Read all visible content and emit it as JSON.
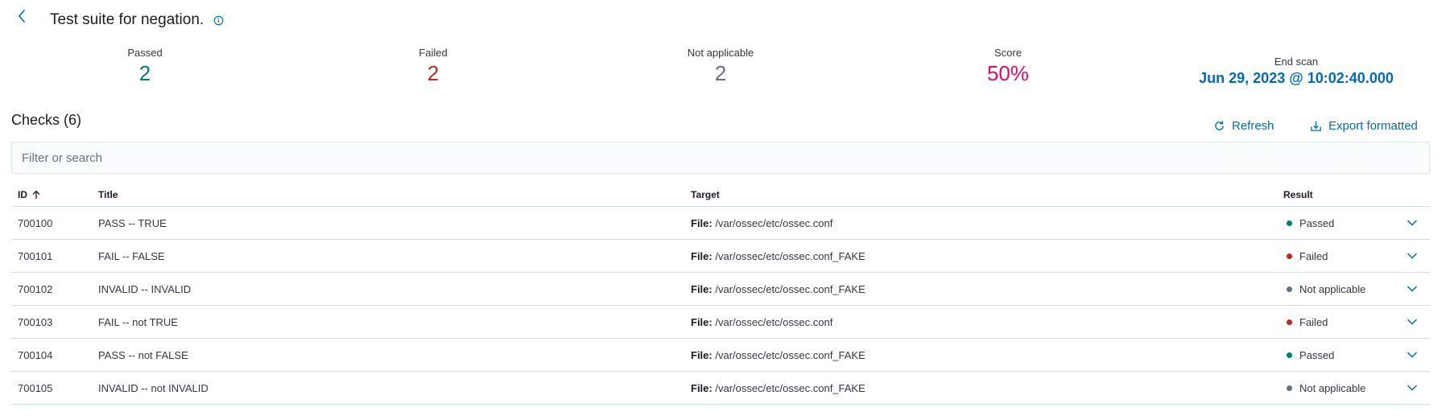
{
  "header": {
    "title": "Test suite for negation.",
    "back_icon": "chevron-left-icon",
    "info_icon": "info-icon"
  },
  "stats": {
    "passed": {
      "label": "Passed",
      "value": "2",
      "color": "#017d73"
    },
    "failed": {
      "label": "Failed",
      "value": "2",
      "color": "#bd271e"
    },
    "not_applicable": {
      "label": "Not applicable",
      "value": "2",
      "color": "#69707d"
    },
    "score": {
      "label": "Score",
      "value": "50%",
      "color": "#dd0a73"
    },
    "end_scan": {
      "label": "End scan",
      "value": "Jun 29, 2023 @ 10:02:40.000",
      "color": "#006bb8"
    }
  },
  "checks": {
    "title": "Checks (6)",
    "refresh_label": "Refresh",
    "export_label": "Export formatted",
    "search_placeholder": "Filter or search"
  },
  "table": {
    "columns": {
      "id": "ID",
      "title": "Title",
      "target": "Target",
      "result": "Result"
    },
    "target_prefix": "File:",
    "rows": [
      {
        "id": "700100",
        "title": "PASS -- TRUE",
        "target": "/var/ossec/etc/ossec.conf",
        "result": "Passed",
        "status": "passed"
      },
      {
        "id": "700101",
        "title": "FAIL -- FALSE",
        "target": "/var/ossec/etc/ossec.conf_FAKE",
        "result": "Failed",
        "status": "failed"
      },
      {
        "id": "700102",
        "title": "INVALID -- INVALID",
        "target": "/var/ossec/etc/ossec.conf_FAKE",
        "result": "Not applicable",
        "status": "na"
      },
      {
        "id": "700103",
        "title": "FAIL -- not TRUE",
        "target": "/var/ossec/etc/ossec.conf",
        "result": "Failed",
        "status": "failed"
      },
      {
        "id": "700104",
        "title": "PASS -- not FALSE",
        "target": "/var/ossec/etc/ossec.conf_FAKE",
        "result": "Passed",
        "status": "passed"
      },
      {
        "id": "700105",
        "title": "INVALID -- not INVALID",
        "target": "/var/ossec/etc/ossec.conf_FAKE",
        "result": "Not applicable",
        "status": "na"
      }
    ]
  },
  "status_colors": {
    "passed": "#017d73",
    "failed": "#bd271e",
    "na": "#69707d"
  },
  "accent": "#006bb8"
}
